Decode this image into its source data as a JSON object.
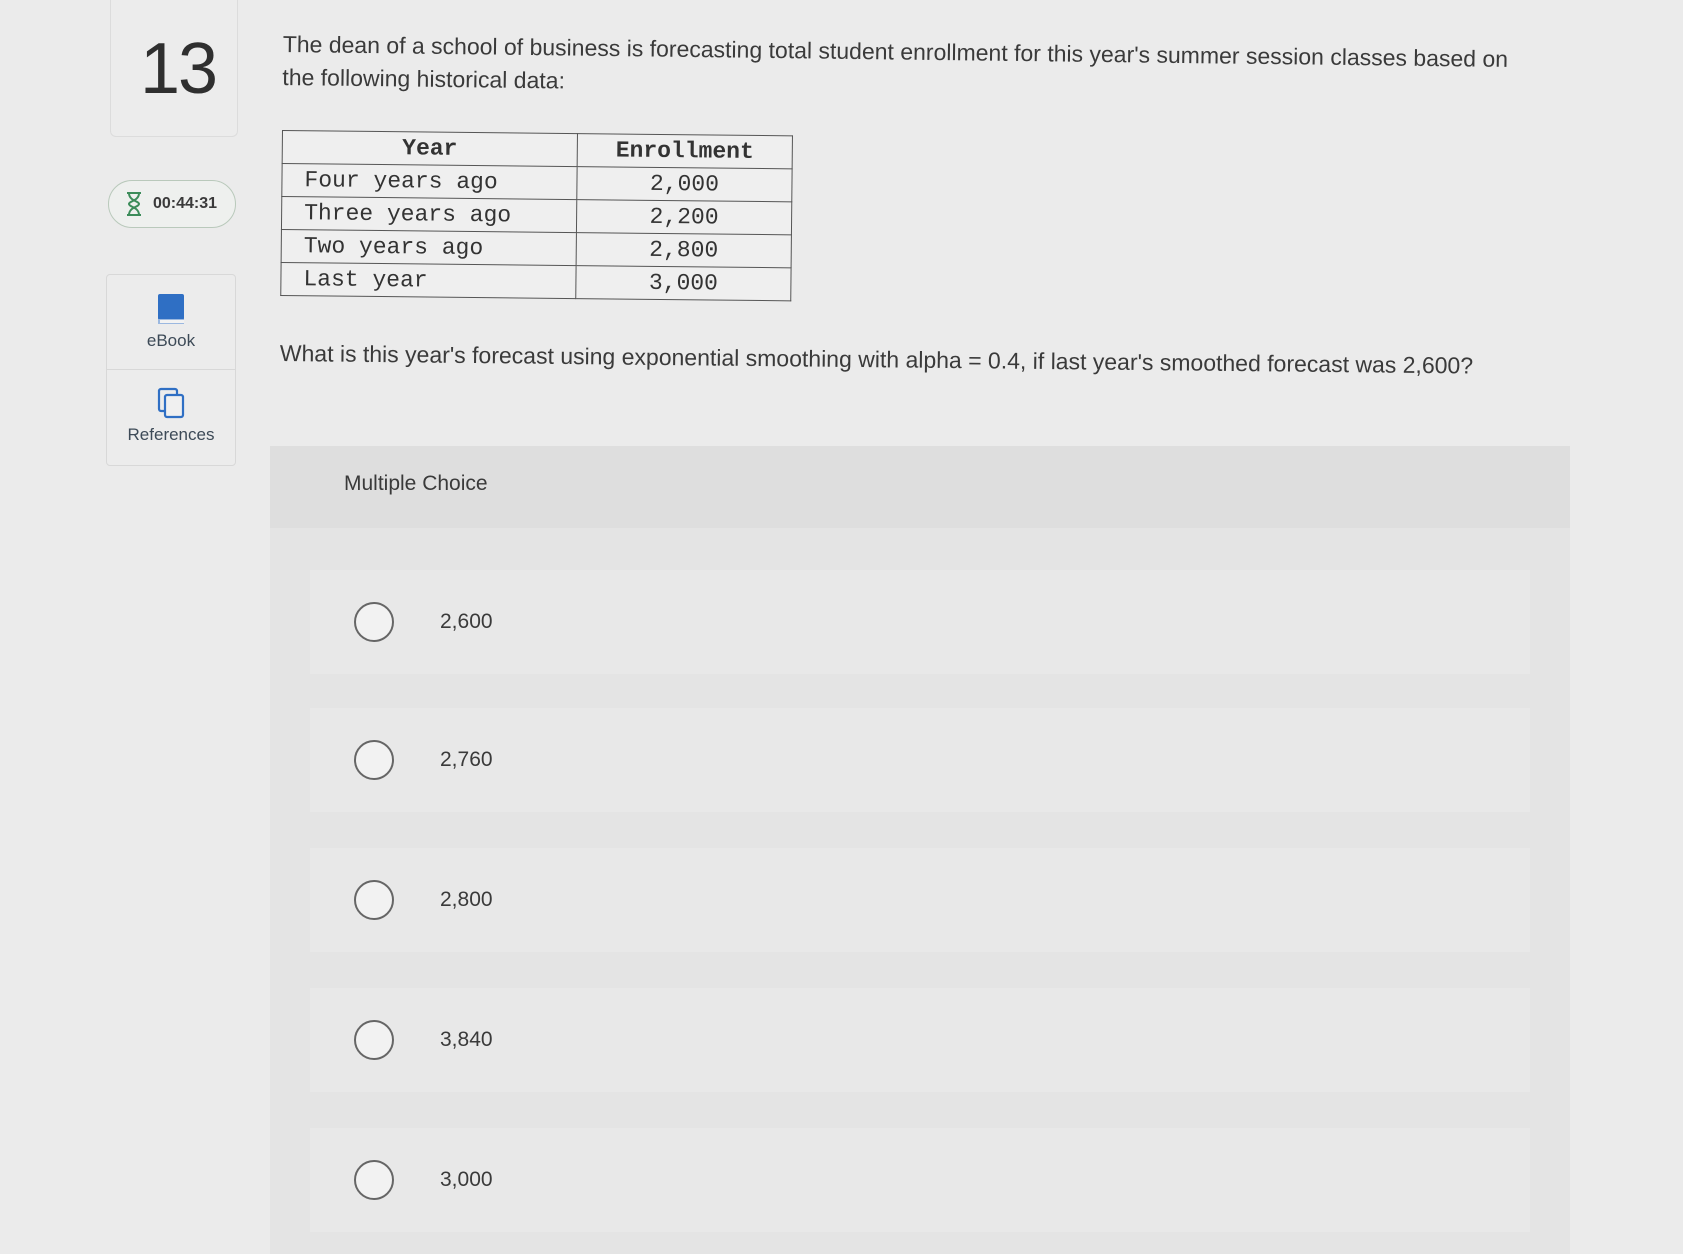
{
  "question_number": "13",
  "timer": "00:44:31",
  "tools": {
    "ebook_label": "eBook",
    "references_label": "References"
  },
  "prompt": "The dean of a school of business is forecasting total student enrollment for this year's summer session classes based on the following historical data:",
  "table": {
    "headers": [
      "Year",
      "Enrollment"
    ],
    "rows": [
      [
        "Four years ago",
        "2,000"
      ],
      [
        "Three years ago",
        "2,200"
      ],
      [
        "Two years ago",
        "2,800"
      ],
      [
        "Last year",
        "3,000"
      ]
    ]
  },
  "question": "What is this year's forecast using exponential smoothing with alpha = 0.4, if last year's smoothed forecast was 2,600?",
  "multiple_choice": {
    "title": "Multiple Choice",
    "options": [
      "2,600",
      "2,760",
      "2,800",
      "3,840",
      "3,000"
    ]
  }
}
